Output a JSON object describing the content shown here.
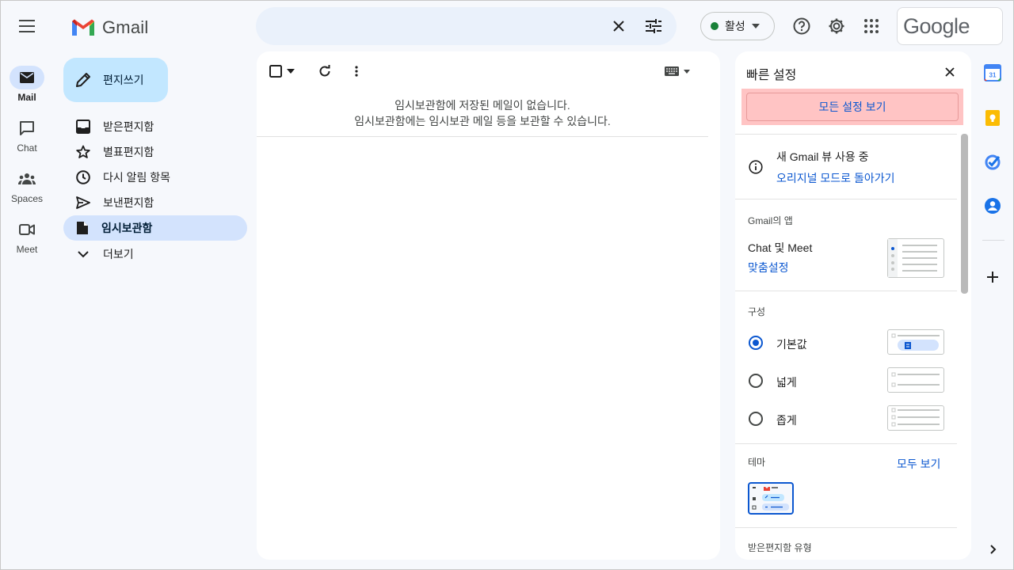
{
  "header": {
    "app_name": "Gmail",
    "status_label": "활성",
    "account_logo": "Google"
  },
  "rail": [
    {
      "label": "Mail",
      "icon": "mail-icon"
    },
    {
      "label": "Chat",
      "icon": "chat-icon"
    },
    {
      "label": "Spaces",
      "icon": "spaces-icon"
    },
    {
      "label": "Meet",
      "icon": "meet-icon"
    }
  ],
  "compose": {
    "label": "편지쓰기"
  },
  "nav": [
    {
      "label": "받은편지함",
      "icon": "inbox-icon"
    },
    {
      "label": "별표편지함",
      "icon": "star-icon"
    },
    {
      "label": "다시 알림 항목",
      "icon": "clock-icon"
    },
    {
      "label": "보낸편지함",
      "icon": "send-icon"
    },
    {
      "label": "임시보관함",
      "icon": "draft-icon"
    },
    {
      "label": "더보기",
      "icon": "chevron-down-icon"
    }
  ],
  "main": {
    "empty_line1": "임시보관함에 저장된 메일이 없습니다.",
    "empty_line2": "임시보관함에는 임시보관 메일 등을 보관할 수 있습니다."
  },
  "quick_settings": {
    "title": "빠른 설정",
    "all_settings": "모든 설정 보기",
    "new_view_text": "새 Gmail 뷰 사용 중",
    "revert_link": "오리지널 모드로 돌아가기",
    "apps_heading": "Gmail의 앱",
    "apps_item": "Chat 및 Meet",
    "apps_customize": "맞춤설정",
    "density_heading": "구성",
    "density_options": [
      "기본값",
      "넓게",
      "좁게"
    ],
    "density_selected": "기본값",
    "theme_heading": "테마",
    "theme_view_all": "모두 보기",
    "inbox_type_heading": "받은편지함 유형"
  },
  "colors": {
    "accent": "#0b57d0",
    "compose_bg": "#c2e7ff",
    "active_nav_bg": "#d3e3fd",
    "status_green": "#188038",
    "highlight": "#ffc4c4"
  }
}
